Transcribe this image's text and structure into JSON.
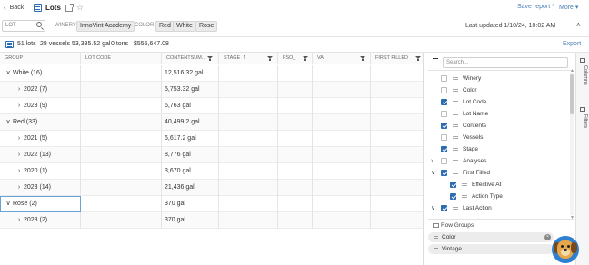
{
  "header": {
    "back_label": "Back",
    "title": "Lots",
    "save_report_label": "Save report *",
    "more_label": "More"
  },
  "filters": {
    "lot_placeholder": "LOT",
    "winery_label": "WINERY",
    "winery_value": "InnoVint Academy",
    "color_label": "COLOR",
    "color_values": [
      "Red",
      "White",
      "Rose"
    ],
    "last_updated": "Last updated 1/10/24, 10:02 AM"
  },
  "summary": {
    "lots": "51 lots",
    "vessels": "28 vessels",
    "gallons": "53,385.52 gal",
    "tons": "0 tons",
    "value": "$555,647.08",
    "export_label": "Export"
  },
  "grid": {
    "columns": [
      "GROUP",
      "LOT CODE",
      "CONTENTSUM...",
      "STAGE",
      "FSO_",
      "VA",
      "FIRST FILLED"
    ],
    "rows": [
      {
        "label": "White (16)",
        "level": 0,
        "expanded": true,
        "contents": "12,516.32 gal"
      },
      {
        "label": "2022 (7)",
        "level": 1,
        "expanded": false,
        "contents": "5,753.32 gal"
      },
      {
        "label": "2023 (9)",
        "level": 1,
        "expanded": false,
        "contents": "6,763 gal"
      },
      {
        "label": "Red (33)",
        "level": 0,
        "expanded": true,
        "contents": "40,499.2 gal"
      },
      {
        "label": "2021 (5)",
        "level": 1,
        "expanded": false,
        "contents": "6,617.2 gal"
      },
      {
        "label": "2022 (13)",
        "level": 1,
        "expanded": false,
        "contents": "8,776 gal"
      },
      {
        "label": "2020 (1)",
        "level": 1,
        "expanded": false,
        "contents": "3,670 gal"
      },
      {
        "label": "2023 (14)",
        "level": 1,
        "expanded": false,
        "contents": "21,436 gal"
      },
      {
        "label": "Rose (2)",
        "level": 0,
        "expanded": true,
        "contents": "370 gal"
      },
      {
        "label": "2023 (2)",
        "level": 1,
        "expanded": false,
        "contents": "370 gal"
      }
    ]
  },
  "panel": {
    "search_placeholder": "Search...",
    "columns": [
      {
        "label": "Winery",
        "checked": false,
        "indent": 0,
        "expandable": false
      },
      {
        "label": "Color",
        "checked": false,
        "indent": 0,
        "expandable": false
      },
      {
        "label": "Lot Code",
        "checked": true,
        "indent": 0,
        "expandable": false
      },
      {
        "label": "Lot Name",
        "checked": false,
        "indent": 0,
        "expandable": false
      },
      {
        "label": "Contents",
        "checked": true,
        "indent": 0,
        "expandable": false
      },
      {
        "label": "Vessels",
        "checked": false,
        "indent": 0,
        "expandable": false
      },
      {
        "label": "Stage",
        "checked": true,
        "indent": 0,
        "expandable": false
      },
      {
        "label": "Analyses",
        "checked": "partial",
        "indent": 0,
        "expandable": "collapsed"
      },
      {
        "label": "First Filled",
        "checked": true,
        "indent": 0,
        "expandable": "expanded"
      },
      {
        "label": "Effective At",
        "checked": true,
        "indent": 1,
        "expandable": false
      },
      {
        "label": "Action Type",
        "checked": true,
        "indent": 1,
        "expandable": false
      },
      {
        "label": "Last Action",
        "checked": true,
        "indent": 0,
        "expandable": "expanded"
      }
    ],
    "row_groups_label": "Row Groups",
    "row_groups": [
      "Color",
      "Vintage"
    ]
  },
  "sidetabs": {
    "columns_label": "Columns",
    "filters_label": "Filters"
  }
}
